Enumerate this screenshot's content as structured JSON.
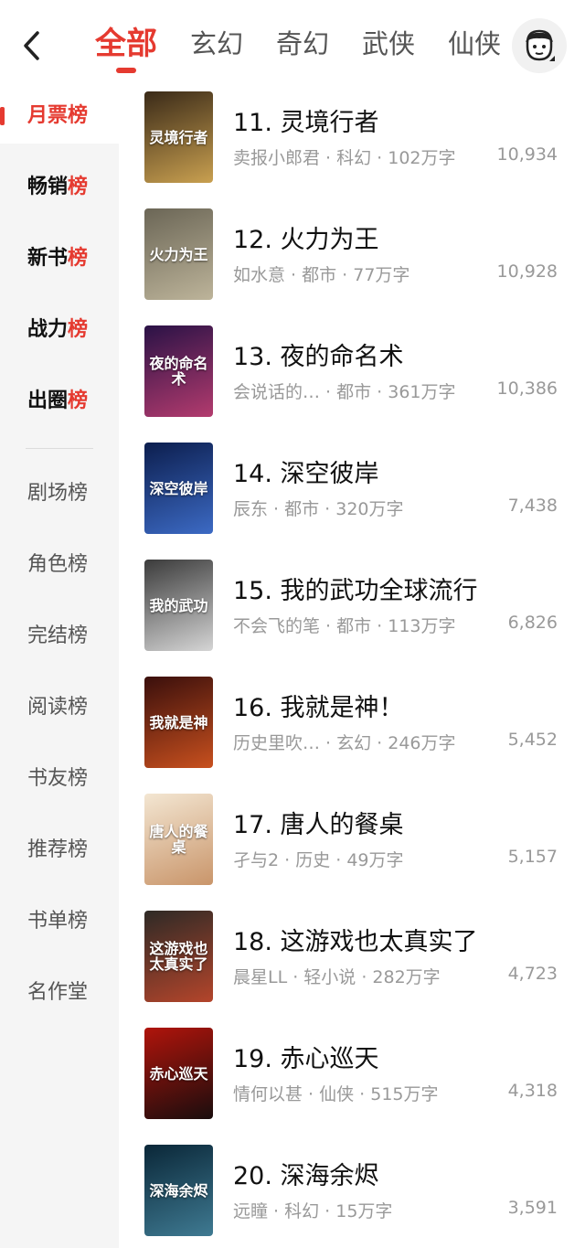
{
  "header": {
    "tabs": [
      "全部",
      "玄幻",
      "奇幻",
      "武侠",
      "仙侠"
    ],
    "active_tab": 0
  },
  "sidebar": {
    "items": [
      {
        "pre": "月票",
        "hl": "榜",
        "bold": true,
        "active": true
      },
      {
        "pre": "畅销",
        "hl": "榜",
        "bold": true
      },
      {
        "pre": "新书",
        "hl": "榜",
        "bold": true
      },
      {
        "pre": "战力",
        "hl": "榜",
        "bold": true
      },
      {
        "pre": "出圈",
        "hl": "榜",
        "bold": true
      },
      {
        "pre": "剧场榜",
        "hl": "",
        "bold": false
      },
      {
        "pre": "角色榜",
        "hl": "",
        "bold": false
      },
      {
        "pre": "完结榜",
        "hl": "",
        "bold": false
      },
      {
        "pre": "阅读榜",
        "hl": "",
        "bold": false
      },
      {
        "pre": "书友榜",
        "hl": "",
        "bold": false
      },
      {
        "pre": "推荐榜",
        "hl": "",
        "bold": false
      },
      {
        "pre": "书单榜",
        "hl": "",
        "bold": false
      },
      {
        "pre": "名作堂",
        "hl": "",
        "bold": false
      }
    ]
  },
  "books": [
    {
      "title": "11. 灵境行者",
      "meta": "卖报小郎君 · 科幻 · 102万字",
      "count": "10,934",
      "cover_text": "灵境行者",
      "colors": [
        "#3a2a18",
        "#c9a050"
      ]
    },
    {
      "title": "12. 火力为王",
      "meta": "如水意 · 都市 · 77万字",
      "count": "10,928",
      "cover_text": "火力为王",
      "colors": [
        "#6b6656",
        "#bdb49a"
      ]
    },
    {
      "title": "13. 夜的命名术",
      "meta": "会说话的…  · 都市 · 361万字",
      "count": "10,386",
      "cover_text": "夜的命名术",
      "colors": [
        "#2a1246",
        "#b33b6e"
      ]
    },
    {
      "title": "14. 深空彼岸",
      "meta": "辰东 · 都市 · 320万字",
      "count": "7,438",
      "cover_text": "深空彼岸",
      "colors": [
        "#0c1e4e",
        "#3c6ac4"
      ]
    },
    {
      "title": "15. 我的武功全球流行",
      "meta": "不会飞的笔 · 都市 · 113万字",
      "count": "6,826",
      "cover_text": "我的武功",
      "colors": [
        "#3b3b3b",
        "#d5d5d5"
      ]
    },
    {
      "title": "16. 我就是神！",
      "meta": "历史里吹…  · 玄幻 · 246万字",
      "count": "5,452",
      "cover_text": "我就是神",
      "colors": [
        "#3a0f0c",
        "#c8501e"
      ]
    },
    {
      "title": "17. 唐人的餐桌",
      "meta": "孑与2 · 历史 · 49万字",
      "count": "5,157",
      "cover_text": "唐人的餐桌",
      "colors": [
        "#f3e6d2",
        "#c9956a"
      ]
    },
    {
      "title": "18. 这游戏也太真实了",
      "meta": "晨星LL · 轻小说 · 282万字",
      "count": "4,723",
      "cover_text": "这游戏也太真实了",
      "colors": [
        "#2e2a26",
        "#b4452b"
      ]
    },
    {
      "title": "19. 赤心巡天",
      "meta": "情何以甚 · 仙侠 · 515万字",
      "count": "4,318",
      "cover_text": "赤心巡天",
      "colors": [
        "#b0140c",
        "#1a0d0d"
      ]
    },
    {
      "title": "20. 深海余烬",
      "meta": "远瞳 · 科幻 · 15万字",
      "count": "3,591",
      "cover_text": "深海余烬",
      "colors": [
        "#0a2738",
        "#3f7a92"
      ]
    }
  ]
}
